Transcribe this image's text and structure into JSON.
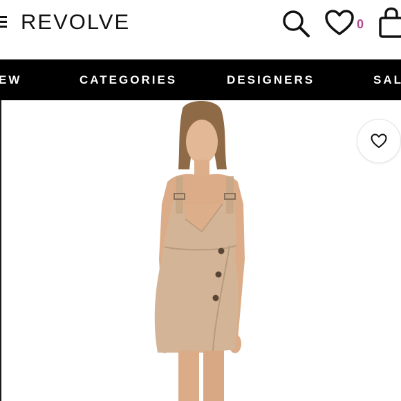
{
  "header": {
    "brand": "REVOLVE",
    "wishlist_count": "0",
    "icons": [
      "menu-icon",
      "search-icon",
      "heart-icon",
      "shopping-bag-icon"
    ]
  },
  "nav": {
    "items": [
      {
        "label": "EW"
      },
      {
        "label": "CATEGORIES"
      },
      {
        "label": "DESIGNERS"
      },
      {
        "label": "SAL"
      }
    ]
  },
  "product": {
    "wishlist_icon": "heart-outline-icon",
    "dress_color": "#d3b497"
  },
  "colors": {
    "nav_background": "#000000",
    "wishlist_count": "#b34b8f",
    "text": "#111111"
  }
}
